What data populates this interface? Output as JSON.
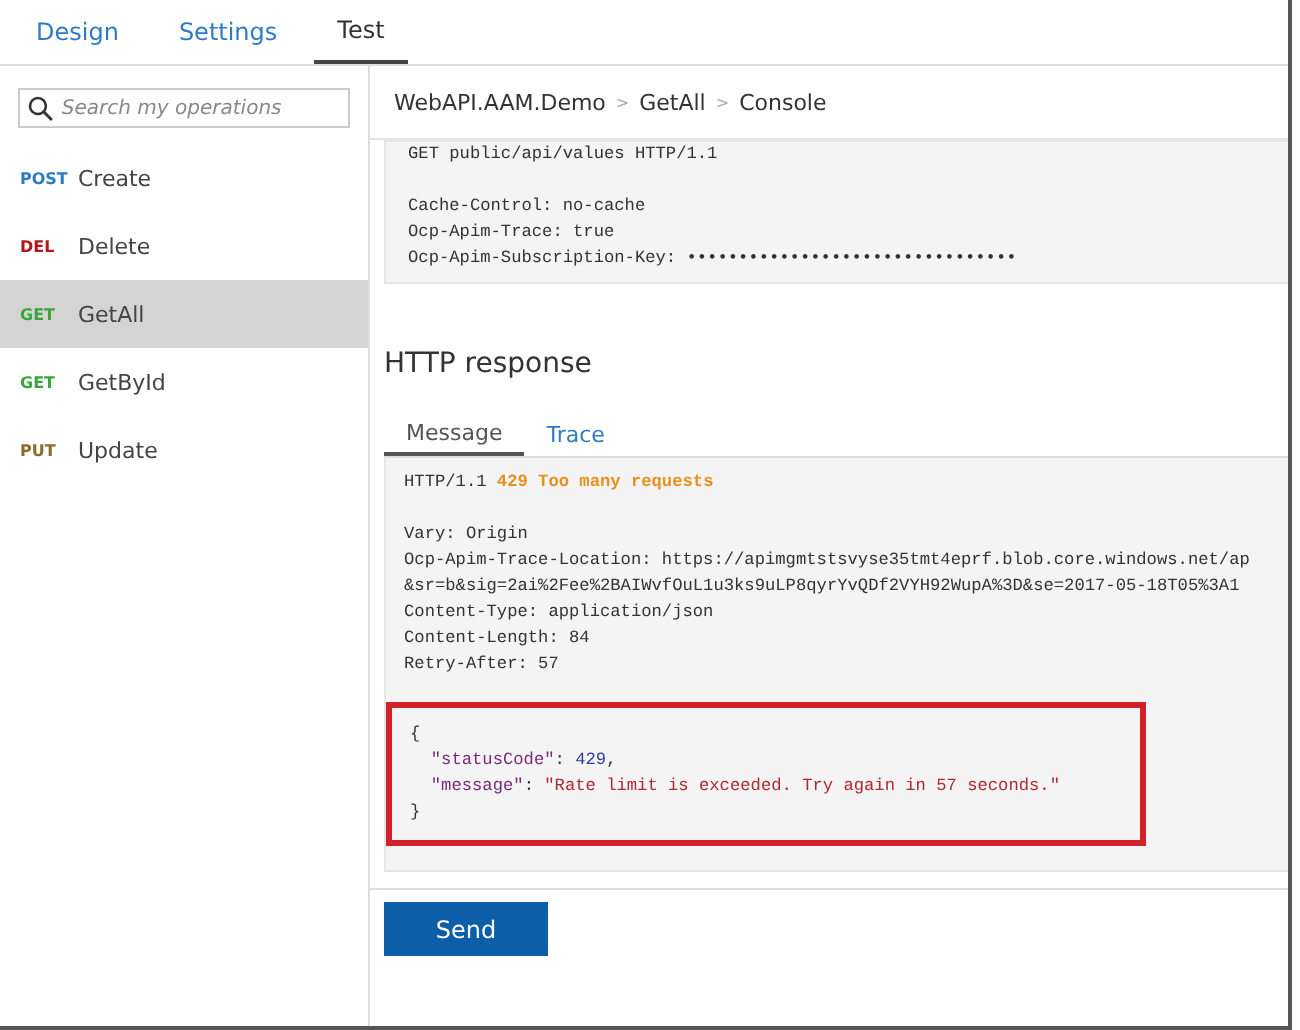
{
  "tabs": [
    {
      "label": "Design",
      "selected": false
    },
    {
      "label": "Settings",
      "selected": false
    },
    {
      "label": "Test",
      "selected": true
    }
  ],
  "sidebar": {
    "search": {
      "placeholder": "Search my operations"
    },
    "operations": [
      {
        "method": "POST",
        "name": "Create",
        "color": "#2e7bc4",
        "selected": false
      },
      {
        "method": "DEL",
        "name": "Delete",
        "color": "#b4141e",
        "selected": false
      },
      {
        "method": "GET",
        "name": "GetAll",
        "color": "#3aa53a",
        "selected": true
      },
      {
        "method": "GET",
        "name": "GetById",
        "color": "#3aa53a",
        "selected": false
      },
      {
        "method": "PUT",
        "name": "Update",
        "color": "#8a6a28",
        "selected": false
      }
    ]
  },
  "breadcrumb": [
    "WebAPI.AAM.Demo",
    "GetAll",
    "Console"
  ],
  "breadcrumb_separators": [
    ">",
    ">"
  ],
  "request": {
    "request_line": "GET public/api/values HTTP/1.1",
    "headers": [
      "Cache-Control: no-cache",
      "Ocp-Apim-Trace: true",
      "Ocp-Apim-Subscription-Key: ••••••••••••••••••••••••••••••••"
    ]
  },
  "response": {
    "title": "HTTP response",
    "tabs": [
      {
        "label": "Message",
        "selected": true
      },
      {
        "label": "Trace",
        "selected": false
      }
    ],
    "status": {
      "version": "HTTP/1.1",
      "code": "429 Too many requests"
    },
    "header_lines": [
      "Vary: Origin",
      "Ocp-Apim-Trace-Location: https://apimgmtstsvyse35tmt4eprf.blob.core.windows.net/ap",
      "&sr=b&sig=2ai%2Fee%2BAIWvfOuL1u3ks9uLP8qyrYvQDf2VYH92WupA%3D&se=2017-05-18T05%3A1",
      "Content-Type: application/json",
      "Content-Length: 84",
      "Retry-After: 57"
    ],
    "body_lines": [
      {
        "indent": false,
        "segments": [
          {
            "kind": "punct",
            "text": "{"
          }
        ]
      },
      {
        "indent": true,
        "segments": [
          {
            "kind": "key",
            "text": "\"statusCode\""
          },
          {
            "kind": "punct",
            "text": ": "
          },
          {
            "kind": "number",
            "text": "429"
          },
          {
            "kind": "punct",
            "text": ","
          }
        ]
      },
      {
        "indent": true,
        "segments": [
          {
            "kind": "key",
            "text": "\"message\""
          },
          {
            "kind": "punct",
            "text": ": "
          },
          {
            "kind": "string",
            "text": "\"Rate limit is exceeded. Try again in 57 seconds.\""
          }
        ]
      },
      {
        "indent": false,
        "segments": [
          {
            "kind": "punct",
            "text": "}"
          }
        ]
      }
    ]
  },
  "send_button": "Send"
}
